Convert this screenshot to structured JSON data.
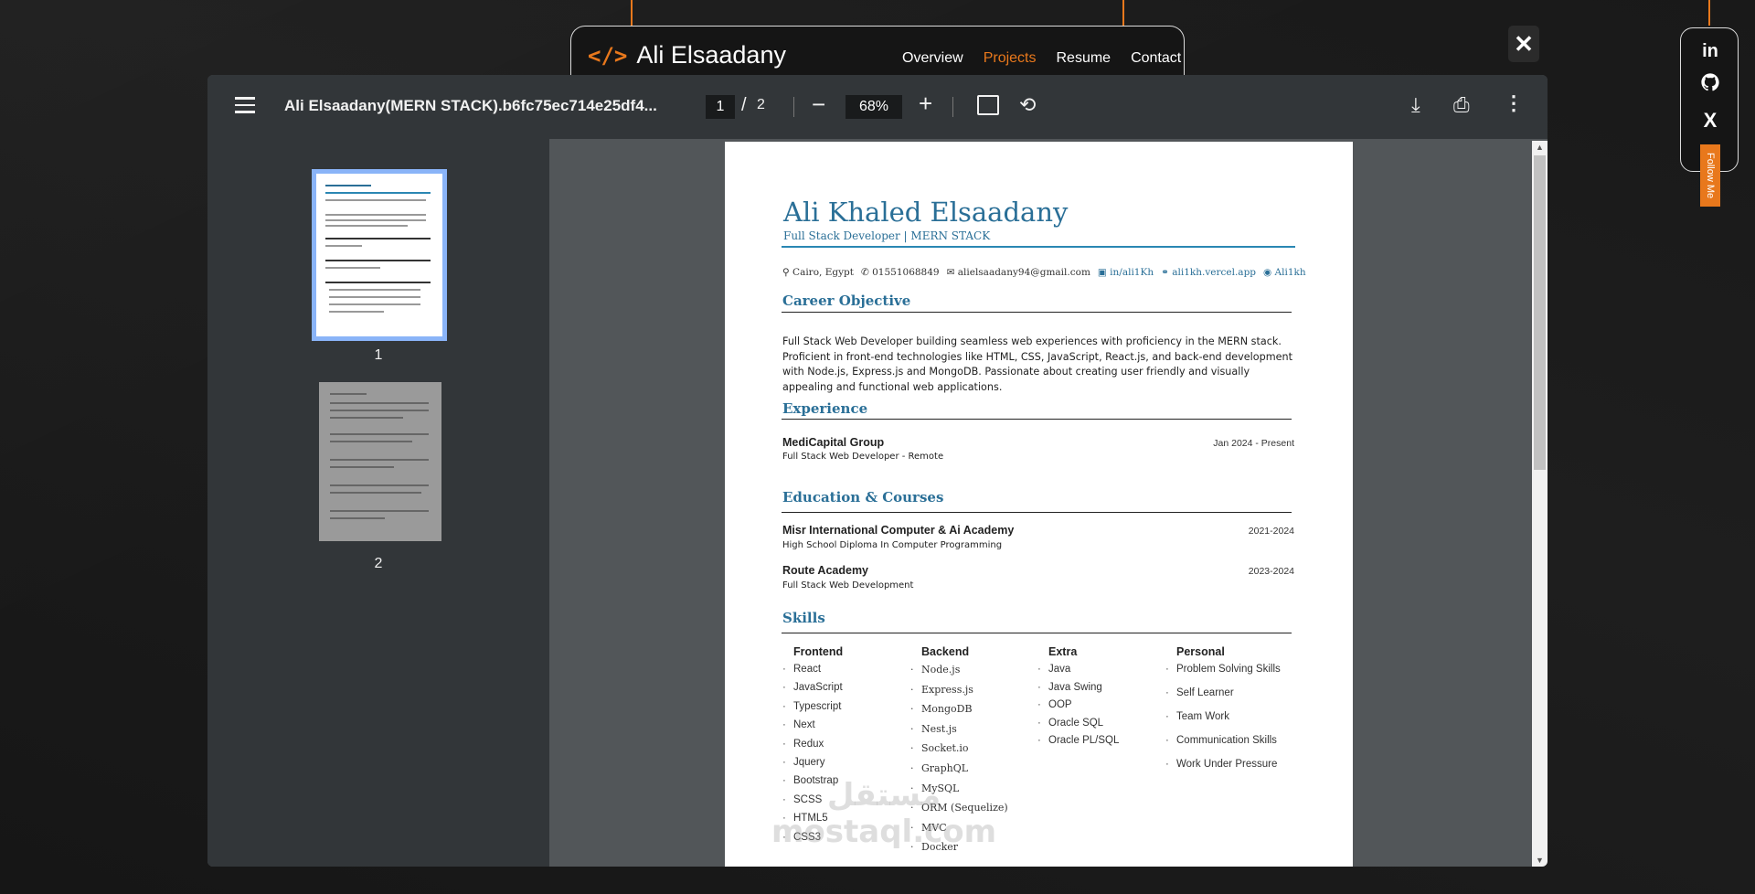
{
  "nav": {
    "brand_icon": "</>",
    "brand_name": "Ali Elsaadany",
    "links": [
      "Overview",
      "Projects",
      "Resume",
      "Contact"
    ],
    "active": "Projects",
    "accent": "#e8781c"
  },
  "close_label": "✕",
  "social": {
    "items": [
      "in",
      "github-icon",
      "X"
    ],
    "follow": "Follow Me"
  },
  "viewer": {
    "file_name": "Ali Elsaadany(MERN STACK).b6fc75ec714e25df4...",
    "page_current": "1",
    "page_total": "2",
    "zoom": "68%",
    "thumb_labels": [
      "1",
      "2"
    ]
  },
  "resume": {
    "name": "Ali Khaled Elsaadany",
    "title": "Full Stack Developer | MERN STACK",
    "contacts": {
      "location": "Cairo, Egypt",
      "phone": "01551068849",
      "email": "alielsaadany94@gmail.com",
      "linkedin": "in/ali1Kh",
      "website": "ali1kh.vercel.app",
      "github": "Ali1kh"
    },
    "career_heading": "Career Objective",
    "career_text": "Full Stack Web Developer building seamless web experiences with proficiency in the MERN stack. Proficient in front-end technologies like HTML, CSS, JavaScript, React.js, and back-end development with Node.js, Express.js and MongoDB. Passionate about creating user friendly and visually appealing and functional web applications.",
    "experience_heading": "Experience",
    "experience": {
      "company": "MediCapital Group",
      "date": "Jan 2024 - Present",
      "role": "Full Stack Web Developer  - Remote"
    },
    "education_heading": "Education & Courses",
    "education": [
      {
        "school": "Misr International Computer & Ai Academy",
        "date": "2021-2024",
        "detail": "High School Diploma In Computer Programming"
      },
      {
        "school": "Route Academy",
        "date": "2023-2024",
        "detail": "Full Stack Web Development"
      }
    ],
    "skills_heading": "Skills",
    "skills": {
      "frontend": {
        "title": "Frontend",
        "items": [
          "React",
          "JavaScript",
          "Typescript",
          "Next",
          "Redux",
          "Jquery",
          "Bootstrap",
          "SCSS",
          "HTML5",
          "CSS3"
        ]
      },
      "backend": {
        "title": "Backend",
        "items": [
          "Node.js",
          "Express.js",
          "MongoDB",
          "Nest.js",
          "Socket.io",
          "GraphQL",
          "MySQL",
          "ORM (Sequelize)",
          "MVC",
          "Docker"
        ]
      },
      "extra": {
        "title": "Extra",
        "items": [
          "Java",
          "Java Swing",
          "OOP",
          "Oracle SQL",
          "Oracle PL/SQL"
        ]
      },
      "personal": {
        "title": "Personal",
        "items": [
          "Problem Solving Skills",
          "Self Learner",
          "Team Work",
          "Communication Skills",
          "Work Under Pressure"
        ]
      }
    }
  },
  "watermark": {
    "arabic": "مستقل",
    "latin": "mostaql.com"
  }
}
